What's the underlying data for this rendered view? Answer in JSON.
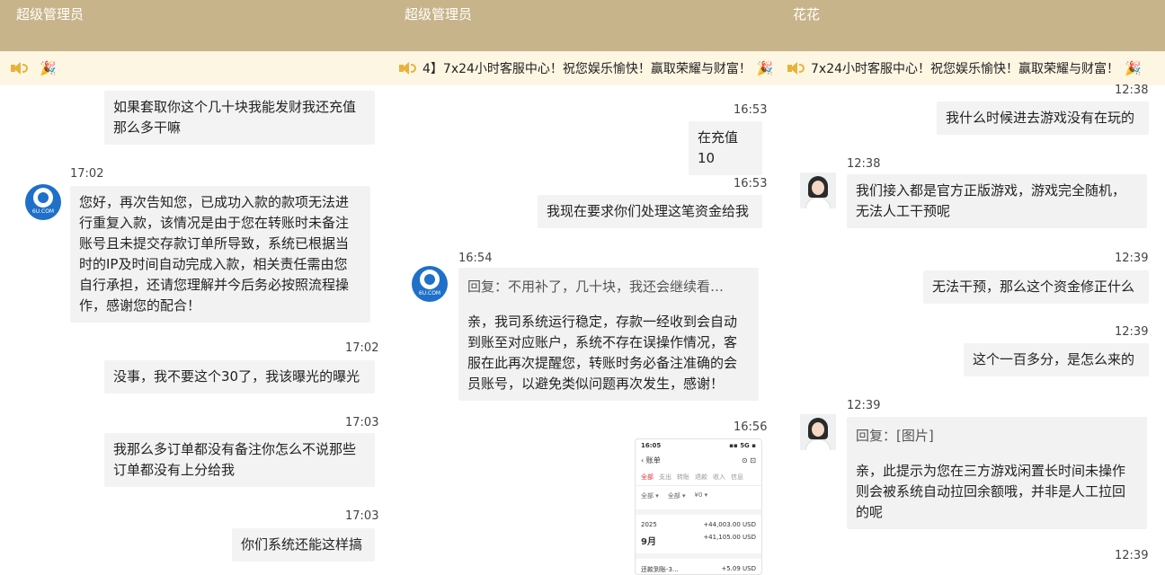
{
  "panels": [
    {
      "title": "超级管理员",
      "marquee": "",
      "timestamps": [
        "17:02",
        "17:02",
        "17:03",
        "17:03"
      ],
      "avatar_text": "6U.COM",
      "bubbles": [
        "如果套取你这个几十块我能发财我还充值\n那么多干嘛",
        "您好，再次告知您，已成功入款的款项无法进\n行重复入款，该情况是由于您在转账时未备注\n账号且未提交存款订单所导致，系统已根据当\n时的IP及时间自动完成入款，相关责任需由您\n自行承担，还请您理解并今后务必按照流程操\n作，感谢您的配合！",
        "没事，我不要这个30了，我该曝光的曝光",
        "我那么多订单都没有备注你怎么不说那些\n订单都没有上分给我",
        "你们系统还能这样搞"
      ]
    },
    {
      "title": "超级管理员",
      "marquee": "4】7x24小时客服中心！祝您娱乐愉快！赢取荣耀与财富！",
      "timestamps": [
        "16:53",
        "16:53",
        "16:54",
        "16:56"
      ],
      "avatar_text": "6U.COM",
      "bubbles": [
        "在充值10",
        "我现在要求你们处理这笔资金给我",
        "回复：不用补了，几十块，我还会继续看…",
        "亲，我司系统运行稳定，存款一经收到会自动\n到账至对应账户，系统不存在误操作情况，客\n服在此再次提醒您，转账时务必备注准确的会\n员账号，以避免类似问题再次发生，感谢！"
      ],
      "phone": {
        "time": "16:05",
        "status_right": "▪▪ 5G ▪",
        "header": "账单",
        "tabs": [
          "全部",
          "支出",
          "转账",
          "退款",
          "收入",
          "信息"
        ],
        "filters": [
          "全部 ▾",
          "全部 ▾",
          "¥0 ▾"
        ],
        "month_label": "2025",
        "month": "9月",
        "sum1": "+44,003.00 USD",
        "sum2": "+41,105.00 USD",
        "item_label": "还款到账-3...",
        "item_amount": "+5.09 USD"
      }
    },
    {
      "title": "花花",
      "marquee": "7x24小时客服中心！祝您娱乐愉快！赢取荣耀与财富！",
      "timestamps": [
        "12:38",
        "12:38",
        "12:39",
        "12:39",
        "12:39",
        "12:39"
      ],
      "bubbles": [
        "我什么时候进去游戏没有在玩的",
        "我们接入都是官方正版游戏，游戏完全随机，\n无法人工干预呢",
        "无法干预，那么这个资金修正什么",
        "这个一百多分，是怎么来的",
        "回复：[图片]",
        "亲，此提示为您在三方游戏闲置长时间未操作\n则会被系统自动拉回余额哦，并非是人工拉回\n的呢"
      ]
    }
  ]
}
